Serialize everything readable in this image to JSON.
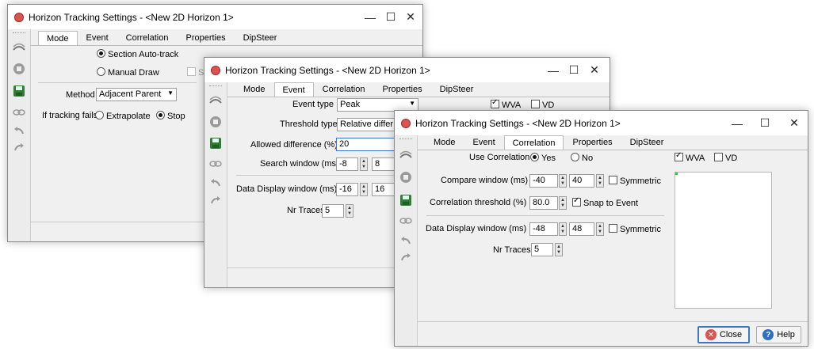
{
  "windows": {
    "mode": {
      "title": "Horizon Tracking Settings - <New 2D Horizon 1>",
      "tabs": [
        "Mode",
        "Event",
        "Correlation",
        "Properties",
        "DipSteer"
      ],
      "section_autotrack": "Section Auto-track",
      "manual_draw": "Manual Draw",
      "hidden_check_label": "S",
      "method_label": "Method",
      "method_value": "Adjacent Parent",
      "if_fails_label": "If tracking fails",
      "extrapolate": "Extrapolate",
      "stop": "Stop"
    },
    "event": {
      "title": "Horizon Tracking Settings - <New 2D Horizon 1>",
      "tabs": [
        "Mode",
        "Event",
        "Correlation",
        "Properties",
        "DipSteer"
      ],
      "event_type_label": "Event type",
      "event_type_value": "Peak",
      "threshold_type_label": "Threshold type",
      "threshold_type_value": "Relative differ",
      "allowed_diff_label": "Allowed difference (%)",
      "allowed_diff_value": "20",
      "search_window_label": "Search window (ms)",
      "search_window_from": "-8",
      "search_window_to": "8",
      "data_display_label": "Data Display window (ms)",
      "data_display_from": "-16",
      "data_display_to": "16",
      "nr_traces_label": "Nr Traces",
      "nr_traces_value": "5",
      "wva": "WVA",
      "vd": "VD"
    },
    "correlation": {
      "title": "Horizon Tracking Settings - <New 2D Horizon 1>",
      "tabs": [
        "Mode",
        "Event",
        "Correlation",
        "Properties",
        "DipSteer"
      ],
      "use_correlation_label": "Use Correlation",
      "yes": "Yes",
      "no": "No",
      "compare_window_label": "Compare window (ms)",
      "compare_from": "-40",
      "compare_to": "40",
      "symmetric": "Symmetric",
      "corr_threshold_label": "Correlation threshold (%)",
      "corr_threshold_value": "80.0",
      "snap_to_event": "Snap to Event",
      "data_display_label": "Data Display window (ms)",
      "data_display_from": "-48",
      "data_display_to": "48",
      "symmetric2": "Symmetric",
      "nr_traces_label": "Nr Traces",
      "nr_traces_value": "5",
      "wva": "WVA",
      "vd": "VD",
      "close_button": "Close",
      "help_button": "Help"
    }
  },
  "colors": {
    "accent": "#3a78c9",
    "close_icon": "#d9534f",
    "help_icon": "#2f6fc0",
    "save_icon": "#2e7d32"
  }
}
